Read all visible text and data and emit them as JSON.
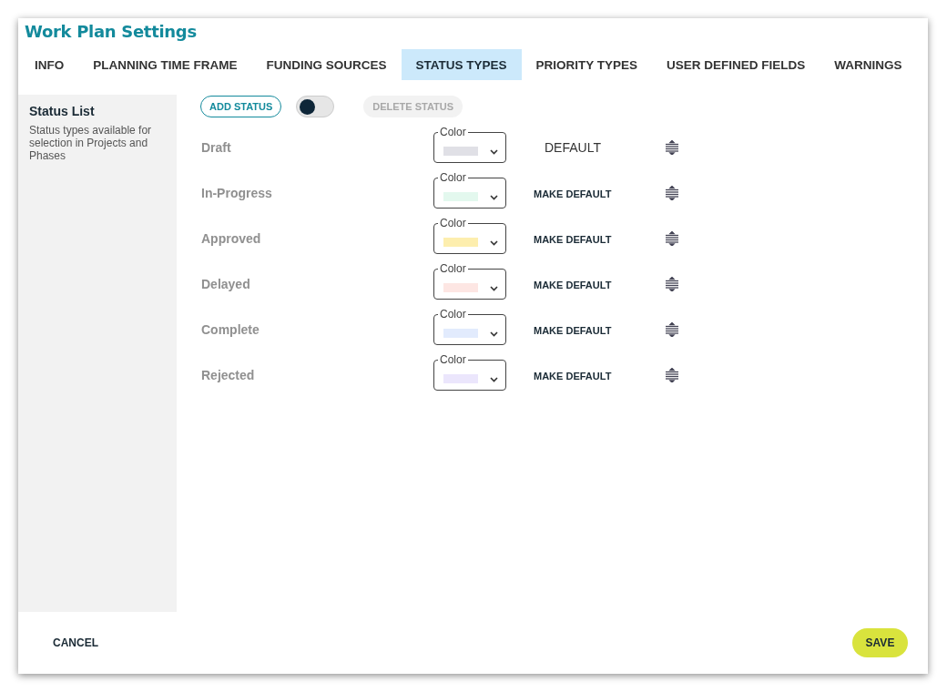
{
  "window": {
    "title": "Work Plan Settings"
  },
  "tabs": [
    {
      "label": "INFO",
      "selected": false
    },
    {
      "label": "PLANNING TIME FRAME",
      "selected": false
    },
    {
      "label": "FUNDING SOURCES",
      "selected": false
    },
    {
      "label": "STATUS TYPES",
      "selected": true
    },
    {
      "label": "PRIORITY TYPES",
      "selected": false
    },
    {
      "label": "USER DEFINED FIELDS",
      "selected": false
    },
    {
      "label": "WARNINGS",
      "selected": false
    }
  ],
  "sidebar": {
    "title": "Status List",
    "description": "Status types available for selection in Projects and Phases"
  },
  "toolbar": {
    "add_button": "ADD STATUS",
    "toggle": {
      "on": false
    },
    "delete_button": {
      "label": "DELETE STATUS",
      "disabled": true
    }
  },
  "statuses": [
    {
      "name": "Draft",
      "color_label": "Color",
      "color": "#e0e0e6",
      "is_default": true,
      "default_label": "DEFAULT"
    },
    {
      "name": "In-Progress",
      "color_label": "Color",
      "color": "#e3f8ee",
      "is_default": false,
      "default_label": "MAKE DEFAULT"
    },
    {
      "name": "Approved",
      "color_label": "Color",
      "color": "#fdeeae",
      "is_default": false,
      "default_label": "MAKE DEFAULT"
    },
    {
      "name": "Delayed",
      "color_label": "Color",
      "color": "#fde6e3",
      "is_default": false,
      "default_label": "MAKE DEFAULT"
    },
    {
      "name": "Complete",
      "color_label": "Color",
      "color": "#e2ebfd",
      "is_default": false,
      "default_label": "MAKE DEFAULT"
    },
    {
      "name": "Rejected",
      "color_label": "Color",
      "color": "#ebe6fc",
      "is_default": false,
      "default_label": "MAKE DEFAULT"
    }
  ],
  "footer": {
    "cancel": "CANCEL",
    "save": "SAVE"
  }
}
